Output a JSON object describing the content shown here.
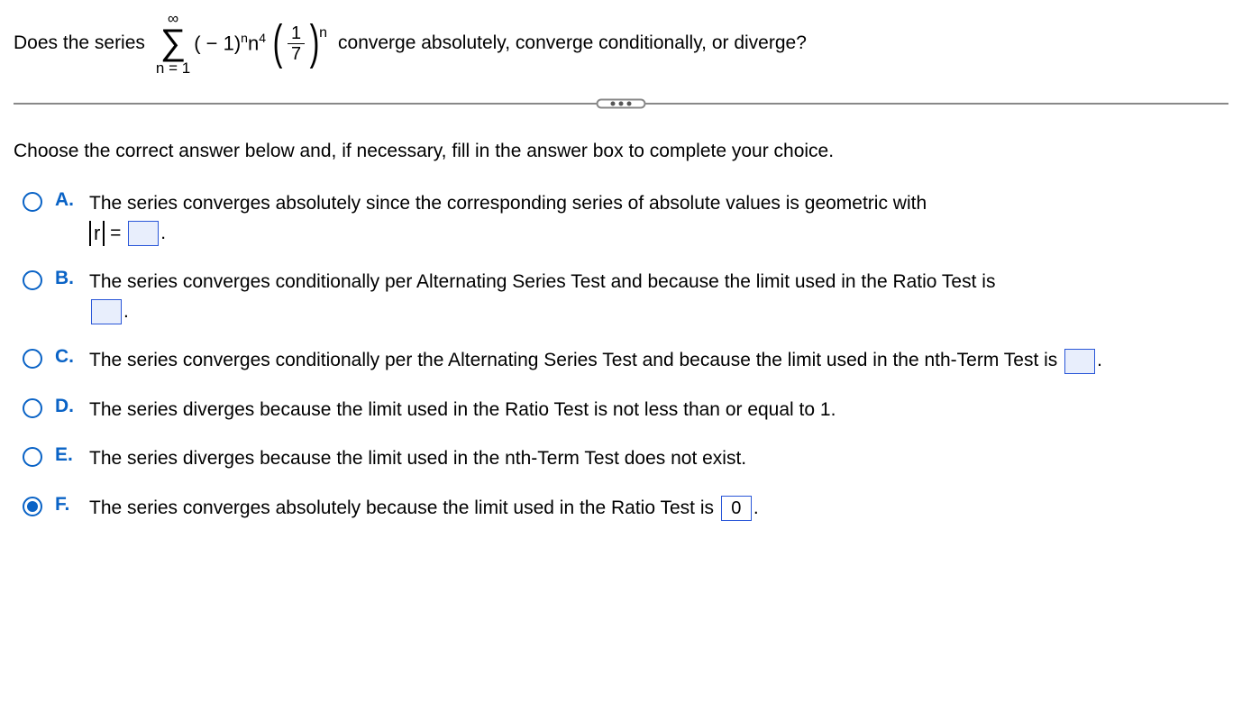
{
  "question": {
    "prefix": "Does the series",
    "sigma": {
      "upper": "∞",
      "lower": "n = 1"
    },
    "term_base": "( − 1)",
    "term_exp1": "n",
    "term_factor": "n",
    "term_exp2": "4",
    "frac": {
      "num": "1",
      "den": "7"
    },
    "outer_exp": "n",
    "suffix": "converge absolutely, converge conditionally, or diverge?"
  },
  "instructions": "Choose the correct answer below and, if necessary, fill in the answer box to complete your choice.",
  "choices": {
    "A": {
      "text_before_box": "The series converges absolutely since the corresponding series of absolute values is geometric with ",
      "abs_label": "r",
      "equals": " = ",
      "box": "",
      "after": "."
    },
    "B": {
      "text_before_box": "The series converges conditionally per Alternating Series Test and because the limit used in the Ratio Test is ",
      "box": "",
      "after": "."
    },
    "C": {
      "text_before_box": "The series converges conditionally per the Alternating Series Test and because the limit used in the nth-Term Test is ",
      "box": "",
      "after": "."
    },
    "D": {
      "text": "The series diverges because the limit used in the Ratio Test is not less than or equal to 1."
    },
    "E": {
      "text": "The series diverges because the limit used in the nth-Term Test does not exist."
    },
    "F": {
      "text_before_box": "The series converges absolutely because the limit used in the Ratio Test is ",
      "box": "0",
      "after": "."
    }
  },
  "selected": "F"
}
